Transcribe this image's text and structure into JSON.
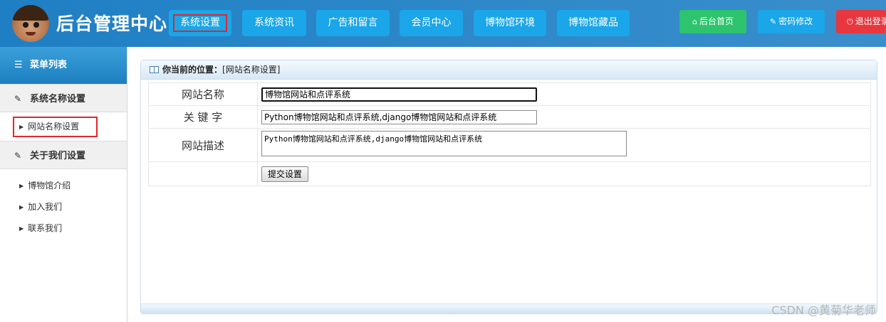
{
  "header": {
    "title": "后台管理中心",
    "nav": [
      {
        "label": "系统设置",
        "active": true
      },
      {
        "label": "系统资讯",
        "active": false
      },
      {
        "label": "广告和留言",
        "active": false
      },
      {
        "label": "会员中心",
        "active": false
      },
      {
        "label": "博物馆环境",
        "active": false
      },
      {
        "label": "博物馆藏品",
        "active": false
      }
    ],
    "actions": {
      "home": {
        "label": "后台首页",
        "icon": "home-icon",
        "color": "#2dc46d"
      },
      "password": {
        "label": "密码修改",
        "icon": "wrench-icon",
        "color": "#1aa6e8"
      },
      "logout": {
        "label": "退出登录",
        "icon": "power-icon",
        "color": "#e8373f"
      }
    }
  },
  "sidebar": {
    "title": "菜单列表",
    "groups": [
      {
        "title": "系统名称设置",
        "items": [
          {
            "label": "网站名称设置",
            "active": true
          }
        ]
      },
      {
        "title": "关于我们设置",
        "items": [
          {
            "label": "博物馆介绍"
          },
          {
            "label": "加入我们"
          },
          {
            "label": "联系我们"
          }
        ]
      }
    ]
  },
  "main": {
    "breadcrumb_label": "你当前的位置：",
    "breadcrumb_value": "[网站名称设置]",
    "form": {
      "site_name_label": "网站名称",
      "site_name_value": "博物馆网站和点评系统",
      "keywords_label": "关 键 字",
      "keywords_value": "Python博物馆网站和点评系统,django博物馆网站和点评系统",
      "description_label": "网站描述",
      "description_value": "Python博物馆网站和点评系统,django博物馆网站和点评系统",
      "submit_label": "提交设置"
    }
  },
  "watermark": "CSDN @黄菊华老师",
  "colors": {
    "header_blue": "#1f7fc4",
    "nav_button": "#1aa6e8",
    "highlight_red": "#e0282b"
  }
}
